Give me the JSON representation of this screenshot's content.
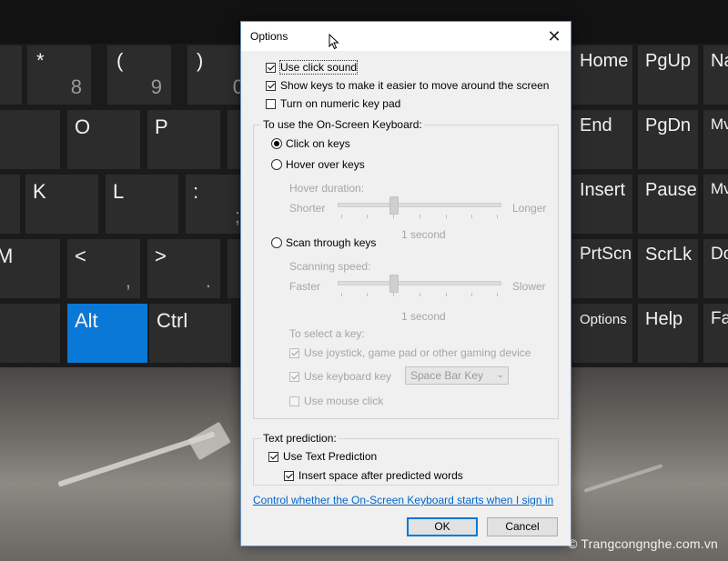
{
  "keyboard": {
    "keys": [
      {
        "id": "8",
        "sym": "*",
        "num": "8"
      },
      {
        "id": "9",
        "sym": "(",
        "num": "9"
      },
      {
        "id": "0",
        "sym": ")",
        "num": "0"
      },
      {
        "id": "o",
        "label": "O"
      },
      {
        "id": "p",
        "label": "P"
      },
      {
        "id": "k",
        "label": "K"
      },
      {
        "id": "l",
        "label": "L"
      },
      {
        "id": "semicolon",
        "label": ":",
        "sub": ";"
      },
      {
        "id": "m",
        "label": "M"
      },
      {
        "id": "comma",
        "label": "<",
        "sub": ","
      },
      {
        "id": "period",
        "label": ">",
        "sub": "."
      },
      {
        "id": "alt",
        "label": "Alt"
      },
      {
        "id": "ctrl",
        "label": "Ctrl"
      },
      {
        "id": "home",
        "label": "Home"
      },
      {
        "id": "pgup",
        "label": "PgUp"
      },
      {
        "id": "nav",
        "label": "Na"
      },
      {
        "id": "end",
        "label": "End"
      },
      {
        "id": "pgdn",
        "label": "PgDn"
      },
      {
        "id": "mv1",
        "label": "Mv"
      },
      {
        "id": "insert",
        "label": "Insert"
      },
      {
        "id": "pause",
        "label": "Pause"
      },
      {
        "id": "mv2",
        "label": "Mv"
      },
      {
        "id": "prtscn",
        "label": "PrtScn"
      },
      {
        "id": "scrlk",
        "label": "ScrLk"
      },
      {
        "id": "dock",
        "label": "Do"
      },
      {
        "id": "options",
        "label": "Options"
      },
      {
        "id": "help",
        "label": "Help"
      },
      {
        "id": "fade",
        "label": "Fa"
      }
    ]
  },
  "dialog": {
    "title": "Options",
    "use_click_sound": {
      "label": "Use click sound",
      "checked": true
    },
    "show_keys": {
      "label": "Show keys to make it easier to move around the screen",
      "checked": true
    },
    "numeric_keypad": {
      "label": "Turn on numeric key pad",
      "checked": false
    },
    "use_group": {
      "label": "To use the On-Screen Keyboard:",
      "click_on_keys": "Click on keys",
      "hover_over_keys": "Hover over keys",
      "hover_duration": "Hover duration:",
      "shorter": "Shorter",
      "longer": "Longer",
      "hover_value": "1 second",
      "scan_through_keys": "Scan through keys",
      "scanning_speed": "Scanning speed:",
      "faster": "Faster",
      "slower": "Slower",
      "scan_value": "1 second",
      "select_a_key": "To select a key:",
      "joystick": "Use joystick, game pad or other gaming device",
      "keyboard_key": "Use keyboard key",
      "keyboard_key_value": "Space Bar Key",
      "mouse_click": "Use mouse click"
    },
    "prediction_group": {
      "label": "Text prediction:",
      "use_text_prediction": "Use Text Prediction",
      "insert_space": "Insert space after predicted words"
    },
    "link": "Control whether the On-Screen Keyboard starts when I sign in",
    "ok": "OK",
    "cancel": "Cancel"
  },
  "watermark": "© Trangcongnghe.com.vn"
}
